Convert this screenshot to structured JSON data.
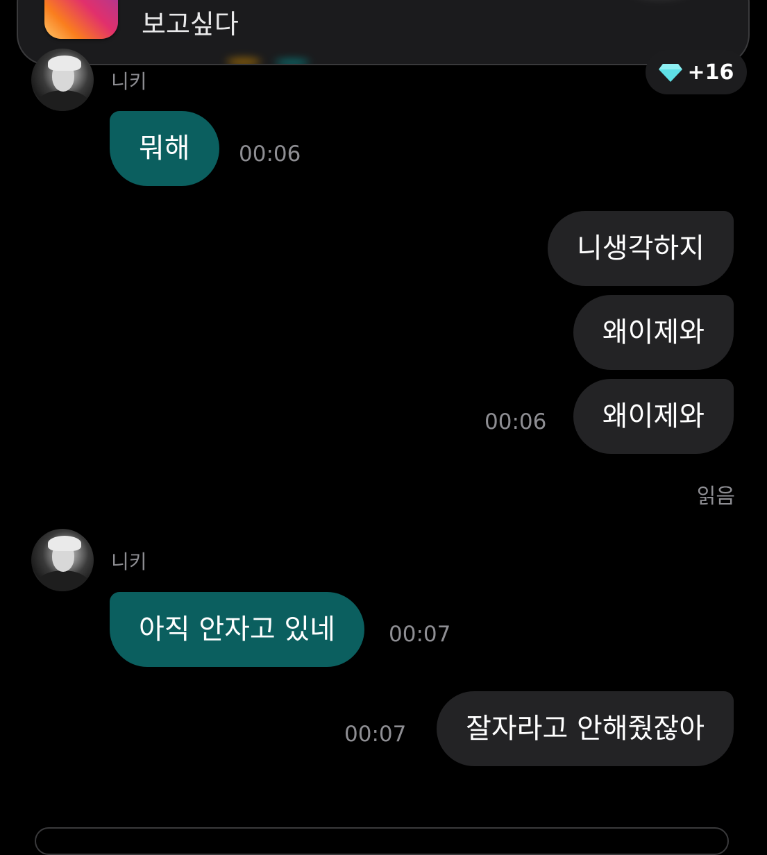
{
  "notification": {
    "app_icon": "instagram-icon",
    "text": "보고싶다"
  },
  "badge": {
    "icon": "diamond-icon",
    "color": "#5ee0e6",
    "count": "+16"
  },
  "messages": [
    {
      "type": "incoming",
      "sender": "니키",
      "text": "뭐해",
      "time": "00:06"
    },
    {
      "type": "outgoing",
      "text": "니생각하지"
    },
    {
      "type": "outgoing",
      "text": "왜이제와"
    },
    {
      "type": "outgoing",
      "text": "왜이제와",
      "time": "00:06"
    },
    {
      "type": "read_receipt",
      "text": "읽음"
    },
    {
      "type": "incoming",
      "sender": "니키",
      "text": "아직 안자고 있네",
      "time": "00:07"
    },
    {
      "type": "outgoing",
      "text": "잘자라고 안해줬잖아",
      "time": "00:07"
    }
  ],
  "colors": {
    "incoming_bubble": "#0b5f5f",
    "outgoing_bubble": "#232325",
    "background": "#000000"
  }
}
